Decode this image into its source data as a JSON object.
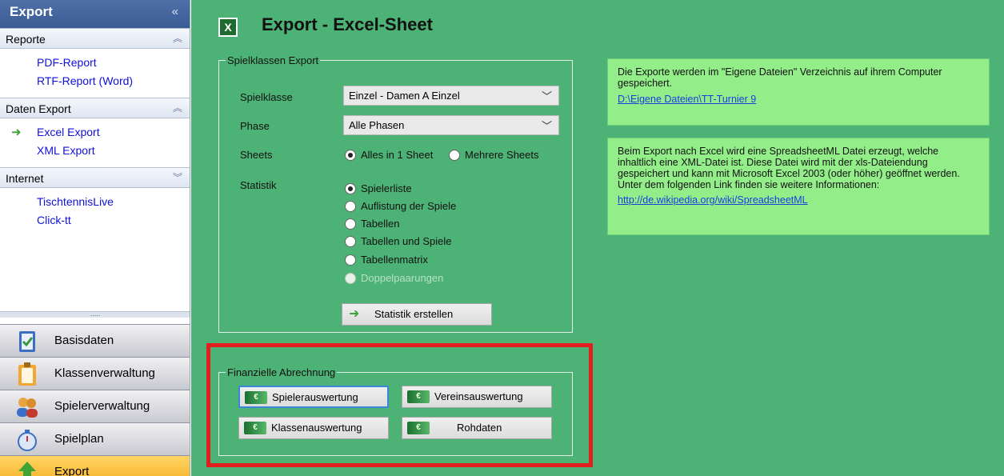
{
  "sidebar": {
    "header": "Export",
    "collapse_glyph": "«",
    "groups": [
      {
        "title": "Reporte",
        "chevron": "≈",
        "items": [
          "PDF-Report",
          "RTF-Report (Word)"
        ]
      },
      {
        "title": "Daten Export",
        "chevron": "≈",
        "items": [
          "Excel Export",
          "XML Export"
        ]
      },
      {
        "title": "Internet",
        "chevron": "≈",
        "items": [
          "TischtennisLive",
          "Click-tt"
        ]
      }
    ],
    "splitter_dots": ".....",
    "nav": [
      "Basisdaten",
      "Klassenverwaltung",
      "Spielerverwaltung",
      "Spielplan",
      "Export"
    ],
    "active_nav": "Export",
    "active_item": "Excel Export"
  },
  "main": {
    "title": "Export - Excel-Sheet",
    "title_icon_glyph": "X",
    "spielklassen": {
      "legend": "Spielklassen Export",
      "spielklasse_label": "Spielklasse",
      "spielklasse_value": "Einzel - Damen A Einzel",
      "phase_label": "Phase",
      "phase_value": "Alle Phasen",
      "sheets_label": "Sheets",
      "sheets_options": [
        "Alles in 1 Sheet",
        "Mehrere Sheets"
      ],
      "statistik_label": "Statistik",
      "statistik_options": [
        "Spielerliste",
        "Auflistung der Spiele",
        "Tabellen",
        "Tabellen und Spiele",
        "Tabellenmatrix",
        "Doppelpaarungen"
      ],
      "create_button": "Statistik erstellen"
    },
    "finanz": {
      "legend": "Finanzielle Abrechnung",
      "buttons": [
        "Spielerauswertung",
        "Vereinsauswertung",
        "Klassenauswertung",
        "Rohdaten"
      ],
      "icon_glyph": "€"
    },
    "info1": {
      "text": "Die Exporte werden im \"Eigene Dateien\" Verzeichnis auf ihrem Computer gespeichert.",
      "link": "D:\\Eigene Dateien\\TT-Turnier 9"
    },
    "info2": {
      "text": "Beim Export nach Excel wird eine SpreadsheetML Datei erzeugt, welche inhaltlich eine XML-Datei ist. Diese Datei wird mit der xls-Dateiendung gespeichert und kann mit Microsoft Excel 2003 (oder höher) geöffnet werden. Unter dem folgenden Link finden sie weitere Informationen:",
      "link": "http://de.wikipedia.org/wiki/SpreadsheetML"
    },
    "highlight_color": "#e31e1e",
    "background_color": "#4db275"
  }
}
